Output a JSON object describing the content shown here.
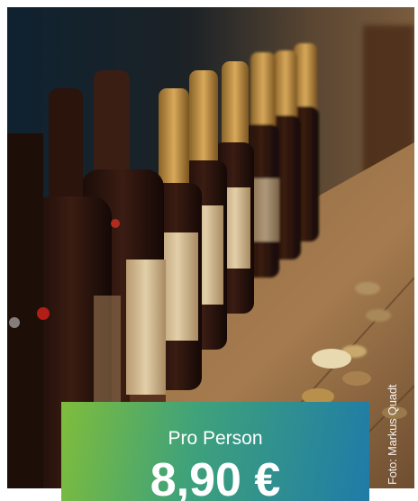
{
  "photo": {
    "subject": "bottles-on-wooden-table",
    "credit": "Foto: Markus Quadt"
  },
  "price": {
    "label": "Pro Person",
    "value": "8,90 €"
  },
  "colors": {
    "gradient_start": "#7fbd3b",
    "gradient_mid": "#3fa27a",
    "gradient_end": "#1f7ba8",
    "text": "#ffffff"
  }
}
